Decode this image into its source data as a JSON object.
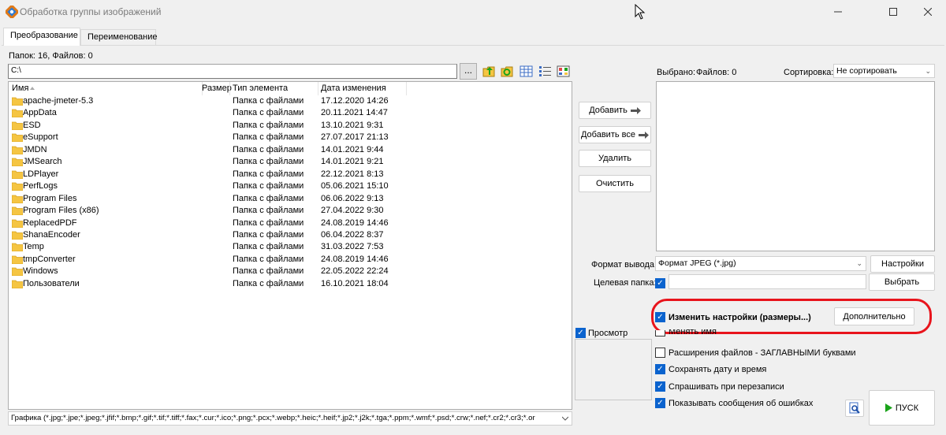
{
  "window": {
    "title": "Обработка группы изображений"
  },
  "icons": {
    "app": "app-icon",
    "minimize": "minimize-icon",
    "maximize": "maximize-icon",
    "close": "close-icon"
  },
  "tabs": [
    {
      "label": "Преобразование",
      "active": true
    },
    {
      "label": "Переименование",
      "active": false
    }
  ],
  "folder_count_text": "Папок: 16, Файлов: 0",
  "path": {
    "value": "C:\\",
    "browse_label": "..."
  },
  "toolbar_icons": [
    "folder-up-icon",
    "folder-refresh-icon",
    "view-details-icon",
    "view-list-icon",
    "view-thumbnails-icon"
  ],
  "filelist": {
    "columns": [
      "Имя",
      "Размер",
      "Тип элемента",
      "Дата изменения"
    ],
    "rows": [
      {
        "name": "apache-jmeter-5.3",
        "type": "Папка с файлами",
        "date": "17.12.2020 14:26"
      },
      {
        "name": "AppData",
        "type": "Папка с файлами",
        "date": "20.11.2021 14:47"
      },
      {
        "name": "ESD",
        "type": "Папка с файлами",
        "date": "13.10.2021 9:31"
      },
      {
        "name": "eSupport",
        "type": "Папка с файлами",
        "date": "27.07.2017 21:13"
      },
      {
        "name": "JMDN",
        "type": "Папка с файлами",
        "date": "14.01.2021 9:44"
      },
      {
        "name": "JMSearch",
        "type": "Папка с файлами",
        "date": "14.01.2021 9:21"
      },
      {
        "name": "LDPlayer",
        "type": "Папка с файлами",
        "date": "22.12.2021 8:13"
      },
      {
        "name": "PerfLogs",
        "type": "Папка с файлами",
        "date": "05.06.2021 15:10"
      },
      {
        "name": "Program Files",
        "type": "Папка с файлами",
        "date": "06.06.2022 9:13"
      },
      {
        "name": "Program Files (x86)",
        "type": "Папка с файлами",
        "date": "27.04.2022 9:30"
      },
      {
        "name": "ReplacedPDF",
        "type": "Папка с файлами",
        "date": "24.08.2019 14:46"
      },
      {
        "name": "ShanaEncoder",
        "type": "Папка с файлами",
        "date": "06.04.2022 8:37"
      },
      {
        "name": "Temp",
        "type": "Папка с файлами",
        "date": "31.03.2022 7:53"
      },
      {
        "name": "tmpConverter",
        "type": "Папка с файлами",
        "date": "24.08.2019 14:46"
      },
      {
        "name": "Windows",
        "type": "Папка с файлами",
        "date": "22.05.2022 22:24"
      },
      {
        "name": "Пользователи",
        "type": "Папка с файлами",
        "date": "16.10.2021 18:04"
      }
    ]
  },
  "filter": "Графика (*.jpg;*.jpe;*.jpeg;*.jfif;*.bmp;*.gif;*.tif;*.tiff;*.fax;*.cur;*.ico;*.png;*.pcx;*.webp;*.heic;*.heif;*.jp2;*.j2k;*.tga;*.ppm;*.wmf;*.psd;*.crw;*.nef;*.cr2;*.cr3;*.or",
  "middle_buttons": {
    "add": "Добавить",
    "add_all": "Добавить все",
    "remove": "Удалить",
    "clear": "Очистить"
  },
  "preview": {
    "label": "Просмотр",
    "checked": true
  },
  "selected": {
    "label": "Выбрано:",
    "files_label": "Файлов: 0",
    "sort_label": "Сортировка:",
    "sort_value": "Не сортировать"
  },
  "output": {
    "format_label": "Формат вывода:",
    "format_value": "Формат JPEG (*.jpg)",
    "settings_button": "Настройки",
    "target_label": "Целевая папка:",
    "target_checked": true,
    "target_value": "",
    "choose_button": "Выбрать"
  },
  "options": {
    "change_settings": {
      "label": "Изменить настройки (размеры...)",
      "checked": true
    },
    "advanced_button": "Дополнительно",
    "rename": {
      "label": "Менять имя",
      "checked": false
    },
    "uppercase_ext": {
      "label": "Расширения файлов - ЗАГЛАВНЫМИ буквами",
      "checked": false
    },
    "keep_date": {
      "label": "Сохранять дату и время",
      "checked": true
    },
    "ask_overwrite": {
      "label": "Спрашивать при перезаписи",
      "checked": true
    },
    "show_errors": {
      "label": "Показывать сообщения об ошибках",
      "checked": true
    }
  },
  "start_button": "ПУСК",
  "colors": {
    "accent": "#0b63ce",
    "highlight": "#e8141c",
    "folder": "#f5c542",
    "start_arrow": "#1aa31a"
  }
}
